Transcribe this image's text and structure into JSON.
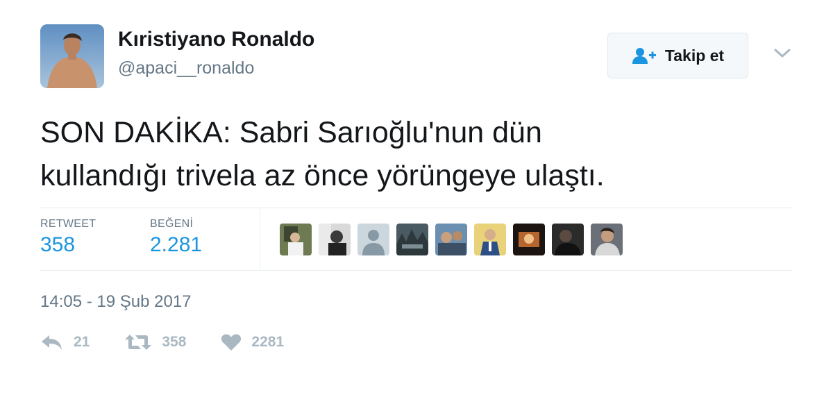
{
  "user": {
    "display_name": "Kıristiyano Ronaldo",
    "handle": "@apaci__ronaldo"
  },
  "follow_button": {
    "label": "Takip et"
  },
  "tweet": {
    "text_line1": "SON DAKİKA: Sabri Sarıoğlu'nun dün",
    "text_line2": "kullandığı trivela az önce yörüngeye ulaştı."
  },
  "stats": {
    "retweet_label": "RETWEET",
    "retweet_count": "358",
    "like_label": "BEĞENİ",
    "like_count": "2.281"
  },
  "timestamp": "14:05 - 19 Şub 2017",
  "actions": {
    "reply_count": "21",
    "retweet_count": "358",
    "like_count": "2281"
  },
  "colors": {
    "link_blue": "#1b95e0",
    "muted_gray": "#657786",
    "action_gray": "#aab8c2"
  }
}
